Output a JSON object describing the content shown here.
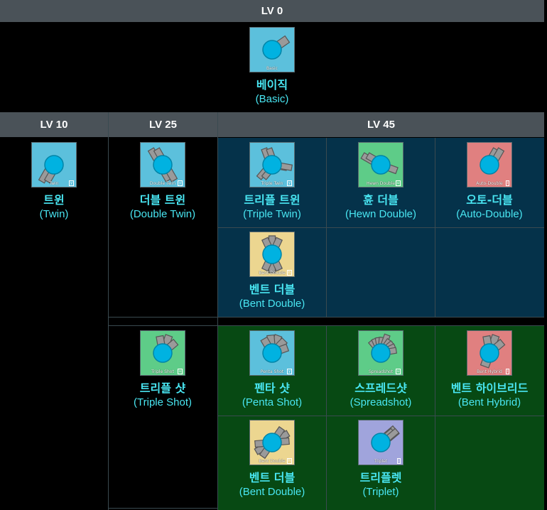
{
  "headers": {
    "lv0": "LV 0",
    "lv10": "LV 10",
    "lv25": "LV 25",
    "lv45": "LV 45"
  },
  "colors": {
    "header_bg": "#4a5258",
    "blue_panel": "#05324a",
    "green_panel": "#074913",
    "name_text": "#49e6f2"
  },
  "tanks": {
    "basic": {
      "kr": "베이직",
      "en": "(Basic)",
      "icon_label": "Basic",
      "key": "",
      "icon": "basic-tank-icon",
      "bg": "#5cc0dc"
    },
    "twin": {
      "kr": "트윈",
      "en": "(Twin)",
      "icon_label": "Twin",
      "key": "y",
      "icon": "twin-tank-icon",
      "bg": "#5cc0dc"
    },
    "double_twin": {
      "kr": "더블 트윈",
      "en": "(Double Twin)",
      "icon_label": "Double Twin",
      "key": "y",
      "icon": "double-twin-tank-icon",
      "bg": "#5cc0dc"
    },
    "triple_twin": {
      "kr": "트리플 트윈",
      "en": "(Triple Twin)",
      "icon_label": "Triple Twin",
      "key": "y",
      "icon": "triple-twin-tank-icon",
      "bg": "#5cc0dc"
    },
    "hewn_double": {
      "kr": "휸 더블",
      "en": "(Hewn Double)",
      "icon_label": "Hewn Double",
      "key": "u",
      "icon": "hewn-double-tank-icon",
      "bg": "#5ecc88"
    },
    "auto_double": {
      "kr": "오토-더블",
      "en": "(Auto-Double)",
      "icon_label": "Auto-Double",
      "key": "i",
      "icon": "auto-double-tank-icon",
      "bg": "#e08080"
    },
    "bent_double_a": {
      "kr": "벤트 더블",
      "en": "(Bent Double)",
      "icon_label": "Bent Double",
      "key": "h",
      "icon": "bent-double-tank-icon",
      "bg": "#ecd690"
    },
    "triple_shot": {
      "kr": "트리플 샷",
      "en": "(Triple Shot)",
      "icon_label": "Triple Shot",
      "key": "u",
      "icon": "triple-shot-tank-icon",
      "bg": "#5ecc88"
    },
    "penta_shot": {
      "kr": "펜타 샷",
      "en": "(Penta Shot)",
      "icon_label": "Penta Shot",
      "key": "y",
      "icon": "penta-shot-tank-icon",
      "bg": "#5cc0dc"
    },
    "spreadshot": {
      "kr": "스프레드샷",
      "en": "(Spreadshot)",
      "icon_label": "Spreadshot",
      "key": "u",
      "icon": "spreadshot-tank-icon",
      "bg": "#5ecc88"
    },
    "bent_hybrid": {
      "kr": "벤트 하이브리드",
      "en": "(Bent Hybrid)",
      "icon_label": "Bent Hybrid",
      "key": "i",
      "icon": "bent-hybrid-tank-icon",
      "bg": "#e08080"
    },
    "bent_double_b": {
      "kr": "벤트 더블",
      "en": "(Bent Double)",
      "icon_label": "Bent Double",
      "key": "h",
      "icon": "bent-double-tank-icon",
      "bg": "#ecd690"
    },
    "triplet": {
      "kr": "트리플렛",
      "en": "(Triplet)",
      "icon_label": "Triplet",
      "key": "j",
      "icon": "triplet-tank-icon",
      "bg": "#a0a4dc"
    }
  }
}
